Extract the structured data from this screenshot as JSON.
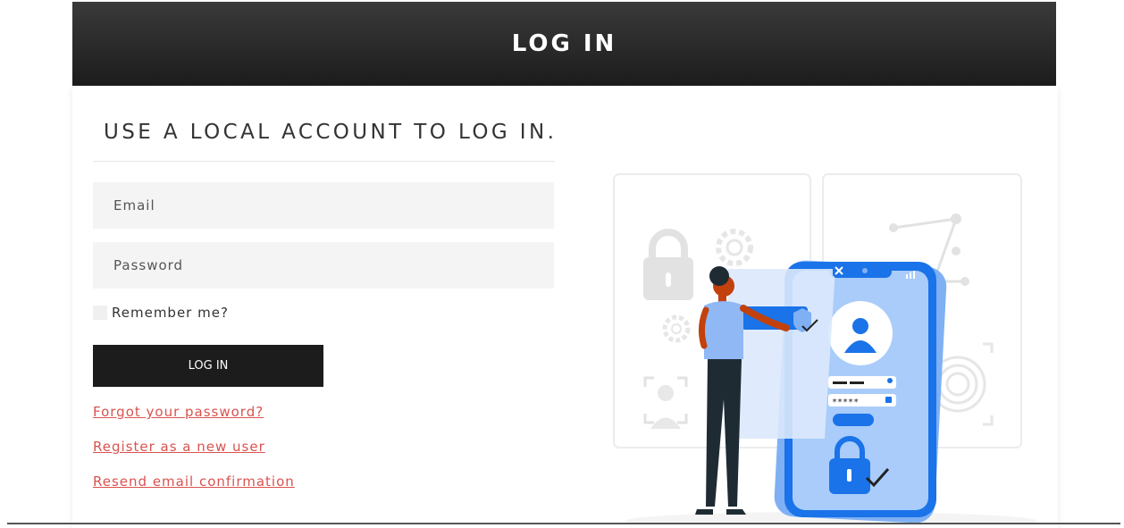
{
  "header": {
    "title": "LOG IN"
  },
  "form": {
    "subtitle": "USE A LOCAL ACCOUNT TO LOG IN.",
    "email_placeholder": "Email",
    "password_placeholder": "Password",
    "remember_label": "Remember me?",
    "login_button": "LOG IN"
  },
  "links": {
    "forgot": "Forgot your password?",
    "register": "Register as a new user",
    "resend": "Resend email confirmation"
  },
  "illustration": {
    "password_mask": "*****",
    "icons": [
      "padlock-icon",
      "gear-icon",
      "fingerprint-icon",
      "face-scan-icon",
      "user-icon",
      "close-icon",
      "checkmark-icon",
      "signal-icon"
    ]
  },
  "colors": {
    "accent": "#1a73e8",
    "link": "#d9534f",
    "header": "#1c1c1c"
  }
}
